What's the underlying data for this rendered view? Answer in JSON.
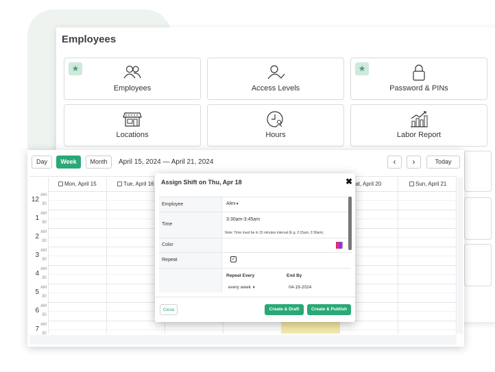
{
  "employees_panel": {
    "title": "Employees",
    "tiles": [
      {
        "label": "Employees",
        "icon": "users-icon",
        "starred": true
      },
      {
        "label": "Access Levels",
        "icon": "user-check-icon",
        "starred": false
      },
      {
        "label": "Password & PINs",
        "icon": "lock-icon",
        "starred": true
      },
      {
        "label": "Locations",
        "icon": "storefront-icon",
        "starred": false
      },
      {
        "label": "Hours",
        "icon": "clock-user-icon",
        "starred": false
      },
      {
        "label": "Labor Report",
        "icon": "bar-chart-trend-icon",
        "starred": false
      }
    ],
    "star_icon": "★"
  },
  "calendar": {
    "view_buttons": {
      "day": "Day",
      "week": "Week",
      "month": "Month"
    },
    "date_range": "April 15, 2024 — April 21, 2024",
    "nav": {
      "prev": "‹",
      "next": "›",
      "today": "Today"
    },
    "day_headers": [
      "Mon, April 15",
      "Tue, April 16",
      "",
      "",
      "",
      "Sat, April 20",
      "Sun, April 21"
    ],
    "hours": [
      {
        "num": "12",
        "am": "AM",
        "half": "30"
      },
      {
        "num": "1",
        "am": "AM",
        "half": "30"
      },
      {
        "num": "2",
        "am": "AM",
        "half": "30"
      },
      {
        "num": "3",
        "am": "AM",
        "half": "30"
      },
      {
        "num": "4",
        "am": "AM",
        "half": "30"
      },
      {
        "num": "5",
        "am": "AM",
        "half": "30"
      },
      {
        "num": "6",
        "am": "AM",
        "half": "30"
      },
      {
        "num": "7",
        "am": "AM",
        "half": "30"
      }
    ],
    "accent": "#2aa876",
    "shift_color": "#f5e9a8"
  },
  "modal": {
    "title": "Assign Shift on Thu, Apr 18",
    "close": "✖",
    "employee_label": "Employee",
    "employee_value": "Alex",
    "time_label": "Time",
    "time_value": "3:30am-3:45am",
    "time_note": "Note: Time must be in 15 minutes interval (E.g. 2:15am, 2:30am).",
    "color_label": "Color",
    "repeat_label": "Repeat",
    "repeat_checked": "✓",
    "repeat_every_label": "Repeat Every",
    "repeat_every_value": "every week",
    "end_by_label": "End By",
    "end_by_value": "04-19-2024",
    "buttons": {
      "close": "Close",
      "draft": "Create & Draft",
      "publish": "Create & Publish"
    }
  }
}
